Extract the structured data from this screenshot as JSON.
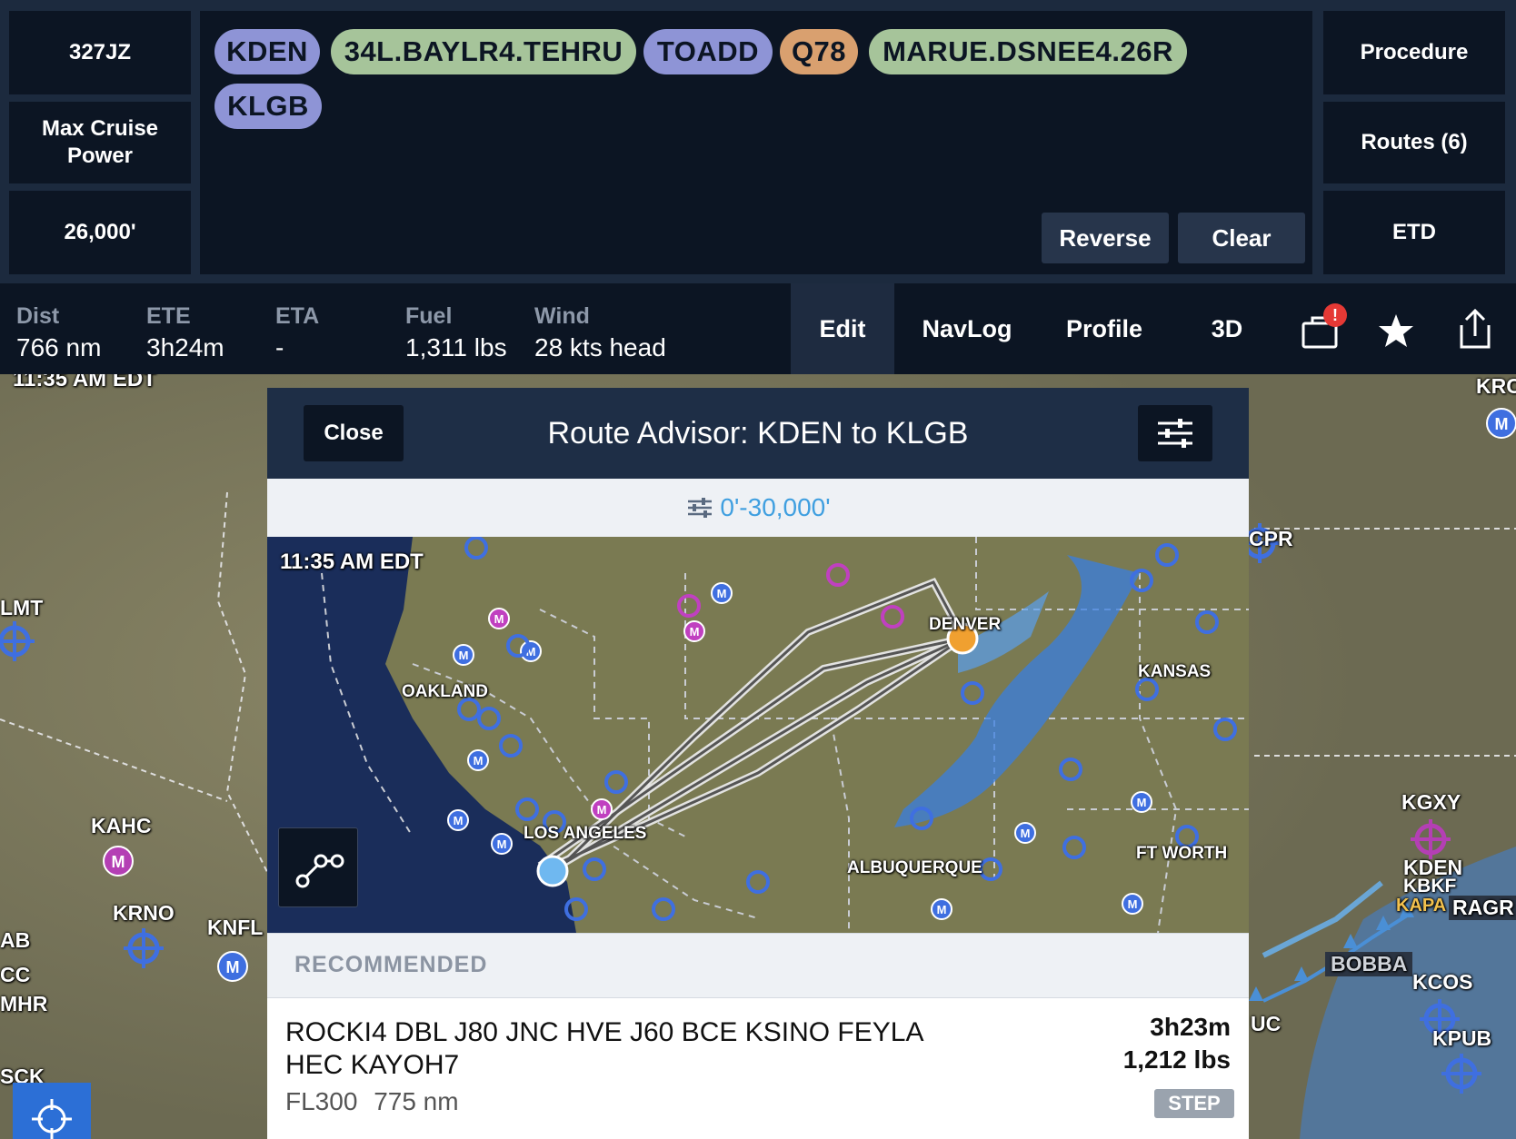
{
  "aircraft": {
    "tail": "327JZ",
    "power": "Max Cruise Power",
    "altitude": "26,000'"
  },
  "route_pills": [
    {
      "label": "KDEN",
      "color": "#8e94d6"
    },
    {
      "label": "34L.BAYLR4.TEHRU",
      "color": "#a6c49a"
    },
    {
      "label": "TOADD",
      "color": "#8e94d6"
    },
    {
      "label": "Q78",
      "color": "#d9a06f"
    },
    {
      "label": "MARUE.DSNEE4.26R",
      "color": "#a6c49a"
    },
    {
      "label": "KLGB",
      "color": "#8e94d6"
    }
  ],
  "route_actions": {
    "reverse": "Reverse",
    "clear": "Clear"
  },
  "right_menu": {
    "procedure": "Procedure",
    "routes": "Routes (6)",
    "etd": "ETD"
  },
  "stats": [
    {
      "label": "Dist",
      "value": "766 nm"
    },
    {
      "label": "ETE",
      "value": "3h24m"
    },
    {
      "label": "ETA",
      "value": "-"
    },
    {
      "label": "Fuel",
      "value": "1,311 lbs"
    },
    {
      "label": "Wind",
      "value": "28 kts head"
    }
  ],
  "tabs": {
    "edit": "Edit",
    "navlog": "NavLog",
    "profile": "Profile",
    "threed": "3D",
    "notification_badge": "!"
  },
  "map": {
    "timestamp": "11:35 AM EDT",
    "labels": {
      "kahc": "KAHC",
      "krno": "KRNO",
      "knfl": "KNFL",
      "lmt": "LMT",
      "ab": "AB",
      "mhr": "MHR",
      "cc": "CC",
      "sck": "SCK",
      "krc": "KRC",
      "cpr": "CPR",
      "kgxy": "KGXY",
      "kden": "KDEN",
      "kbkf": "KBKF",
      "kapa": "KAPA",
      "ragr": "RAGR",
      "bobba": "BOBBA",
      "kcos": "KCOS",
      "kpub": "KPUB",
      "uc": "UC"
    },
    "airport_marker": "M"
  },
  "route_advisor": {
    "close": "Close",
    "title": "Route Advisor: KDEN to KLGB",
    "filter": "0'-30,000'",
    "mini_map": {
      "timestamp": "11:35 AM EDT",
      "labels": {
        "oakland": "OAKLAND",
        "los_angeles": "LOS ANGELES",
        "denver": "DENVER",
        "kansas": "KANSAS",
        "albuquerque": "ALBUQUERQUE",
        "ft_worth": "FT WORTH"
      }
    },
    "section_title": "RECOMMENDED",
    "recommended": {
      "route_line1": "ROCKI4 DBL J80 JNC HVE J60 BCE KSINO FEYLA",
      "route_line2": "HEC KAYOH7",
      "altitude": "FL300",
      "distance": "775 nm",
      "time": "3h23m",
      "fuel": "1,212 lbs",
      "tag": "STEP"
    }
  }
}
